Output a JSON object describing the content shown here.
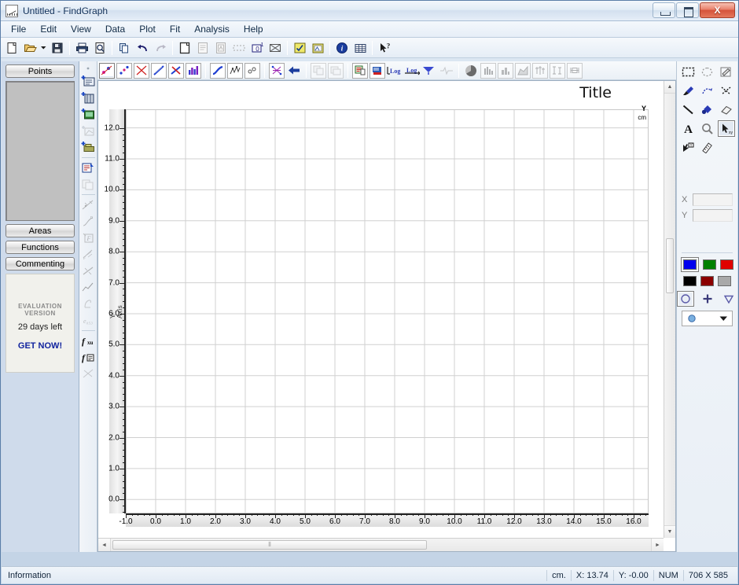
{
  "window": {
    "title": "Untitled - FindGraph",
    "icon": "findgraph-app-icon",
    "minimize": "Minimize",
    "maximize": "Restore",
    "close": "Close"
  },
  "menu": {
    "items": [
      {
        "label": "File"
      },
      {
        "label": "Edit"
      },
      {
        "label": "View"
      },
      {
        "label": "Data"
      },
      {
        "label": "Plot"
      },
      {
        "label": "Fit"
      },
      {
        "label": "Analysis"
      },
      {
        "label": "Help"
      }
    ]
  },
  "main_toolbar": {
    "items": [
      {
        "name": "new-file-icon",
        "title": "New"
      },
      {
        "name": "open-file-icon",
        "title": "Open"
      },
      {
        "name": "open-dropdown-icon",
        "title": "Open recent"
      },
      {
        "name": "save-icon",
        "title": "Save"
      },
      {
        "name": "print-icon",
        "title": "Print"
      },
      {
        "name": "print-preview-icon",
        "title": "Print Preview"
      },
      {
        "name": "copy-icon",
        "title": "Copy"
      },
      {
        "name": "undo-icon",
        "title": "Undo"
      },
      {
        "name": "redo-icon",
        "title": "Redo"
      },
      {
        "name": "new-document-icon",
        "title": "New Document"
      },
      {
        "name": "paste-document-icon",
        "title": "Paste Document"
      },
      {
        "name": "import-document-icon",
        "title": "Import"
      },
      {
        "name": "select-region-icon",
        "title": "Select Region"
      },
      {
        "name": "digitize-icon",
        "title": "Digitize"
      },
      {
        "name": "delete-region-icon",
        "title": "Delete Region"
      },
      {
        "name": "wizard-icon",
        "title": "Wizard"
      },
      {
        "name": "image-icon",
        "title": "Image"
      },
      {
        "name": "about-icon",
        "title": "About"
      },
      {
        "name": "table-icon",
        "title": "Table"
      },
      {
        "name": "help-pointer-icon",
        "title": "Context Help"
      }
    ]
  },
  "graph_toolbar": {
    "items": [
      {
        "name": "scatter-select-icon",
        "title": "Points",
        "selected": true
      },
      {
        "name": "scatter-plot-icon",
        "title": "Scatter"
      },
      {
        "name": "clear-plot-icon",
        "title": "Clear"
      },
      {
        "name": "line-plot-icon",
        "title": "Line"
      },
      {
        "name": "delete-curve-icon",
        "title": "Delete Curve"
      },
      {
        "name": "bar-plot-icon",
        "title": "Bar"
      },
      {
        "name": "smooth-curve-icon",
        "title": "Smooth"
      },
      {
        "name": "noise-icon",
        "title": "Noise"
      },
      {
        "name": "spline-icon",
        "title": "Spline"
      },
      {
        "name": "network-icon",
        "title": "Approximation"
      },
      {
        "name": "back-arrow-icon",
        "title": "Back"
      },
      {
        "name": "copy-plot-icon",
        "title": "Copy Plot"
      },
      {
        "name": "duplicate-plot-icon",
        "title": "Duplicate Plot"
      },
      {
        "name": "legend-icon",
        "title": "Legend"
      },
      {
        "name": "axis-props-icon",
        "title": "Axis Properties"
      },
      {
        "name": "log-x-icon",
        "title": "Log X"
      },
      {
        "name": "log-y-icon",
        "title": "Log Y"
      },
      {
        "name": "fft-icon",
        "title": "FFT"
      },
      {
        "name": "signal-icon",
        "title": "Signal"
      },
      {
        "name": "pie-icon",
        "title": "Pie Chart"
      },
      {
        "name": "histogram-icon",
        "title": "Histogram"
      },
      {
        "name": "column-icon",
        "title": "Column Chart"
      },
      {
        "name": "area-icon",
        "title": "Area Chart"
      },
      {
        "name": "candle-icon",
        "title": "Candlestick"
      },
      {
        "name": "errorbar-icon",
        "title": "Error Bars"
      },
      {
        "name": "boxplot-icon",
        "title": "Box Plot"
      }
    ]
  },
  "sidebar": {
    "points_button": "Points",
    "areas_button": "Areas",
    "functions_button": "Functions",
    "commenting_button": "Commenting",
    "evaluation": {
      "line1": "EVALUATION",
      "line2": "VERSION",
      "days_left": "29 days left",
      "buy_link": "GET NOW!"
    },
    "tools": [
      {
        "name": "add-series-icon",
        "title": "Add Series"
      },
      {
        "name": "add-column-icon",
        "title": "Add Column"
      },
      {
        "name": "add-image-icon",
        "title": "Add Image"
      },
      {
        "name": "add-area-icon",
        "title": "Add Area"
      },
      {
        "name": "add-folder-icon",
        "title": "Add Folder"
      },
      {
        "name": "edit-series-icon",
        "title": "Edit Series"
      },
      {
        "name": "copy-series-icon",
        "title": "Copy Series"
      },
      {
        "name": "interpolate-icon",
        "title": "Interpolate"
      },
      {
        "name": "power-fit-icon",
        "title": "Power Fit"
      },
      {
        "name": "formula-fit-icon",
        "title": "Formula Fit"
      },
      {
        "name": "fourier-icon",
        "title": "Fourier"
      },
      {
        "name": "regression-icon",
        "title": "Regression"
      },
      {
        "name": "trend-icon",
        "title": "Trend Line"
      },
      {
        "name": "smooth-hand-icon",
        "title": "Smoothing"
      },
      {
        "name": "spline-fit-icon",
        "title": "Spline Fit"
      },
      {
        "name": "function-fit-icon",
        "title": "Function Fit"
      },
      {
        "name": "function-list-icon",
        "title": "Function List"
      },
      {
        "name": "cut-curve-icon",
        "title": "Cut Curve"
      }
    ]
  },
  "right_panel": {
    "tools": [
      {
        "name": "marquee-select-icon",
        "title": "Rectangular Select"
      },
      {
        "name": "lasso-select-icon",
        "title": "Lasso Select"
      },
      {
        "name": "edit-note-icon",
        "title": "Note"
      },
      {
        "name": "eyedropper-icon",
        "title": "Eyedropper"
      },
      {
        "name": "freehand-icon",
        "title": "Freehand"
      },
      {
        "name": "delete-point-icon",
        "title": "Delete Point"
      },
      {
        "name": "line-tool-icon",
        "title": "Line"
      },
      {
        "name": "paint-bucket-icon",
        "title": "Fill"
      },
      {
        "name": "eraser-icon",
        "title": "Eraser"
      },
      {
        "name": "text-tool-icon",
        "title": "Text"
      },
      {
        "name": "zoom-icon",
        "title": "Zoom"
      },
      {
        "name": "pointer-tool-icon",
        "title": "Select",
        "selected": true
      },
      {
        "name": "move-point-icon",
        "title": "Move Point"
      },
      {
        "name": "ruler-icon",
        "title": "Measure"
      }
    ],
    "coords": {
      "x_label": "X",
      "y_label": "Y",
      "x_value": "",
      "y_value": ""
    },
    "colors": {
      "row1": [
        "#0000ee",
        "#008000",
        "#e00000"
      ],
      "row2": [
        "#000000",
        "#8b0000",
        "#a9a9a9"
      ],
      "selected_index": 0
    },
    "shapes": [
      {
        "name": "circle-marker-icon",
        "selected": true
      },
      {
        "name": "plus-marker-icon",
        "selected": false
      },
      {
        "name": "triangle-marker-icon",
        "selected": false
      }
    ],
    "marker_combo": {
      "name": "marker-style-combo",
      "value": "circle-marker"
    }
  },
  "chart_data": {
    "type": "scatter",
    "title": "Title",
    "xlabel": "",
    "ylabel": "Y-Axis",
    "y_top_symbol": "Y",
    "y_units": "cm",
    "xlim": [
      -1.0,
      16.5
    ],
    "ylim": [
      -0.45,
      12.6
    ],
    "x_ticks": [
      "-1.0",
      "0.0",
      "1.0",
      "2.0",
      "3.0",
      "4.0",
      "5.0",
      "6.0",
      "7.0",
      "8.0",
      "9.0",
      "10.0",
      "11.0",
      "12.0",
      "13.0",
      "14.0",
      "15.0",
      "16.0"
    ],
    "x_tick_values": [
      -1,
      0,
      1,
      2,
      3,
      4,
      5,
      6,
      7,
      8,
      9,
      10,
      11,
      12,
      13,
      14,
      15,
      16
    ],
    "y_ticks": [
      "12.0",
      "11.0",
      "10.0",
      "9.0",
      "8.0",
      "7.0",
      "6.0",
      "5.0",
      "4.0",
      "3.0",
      "2.0",
      "1.0",
      "0.0"
    ],
    "y_tick_values": [
      12,
      11,
      10,
      9,
      8,
      7,
      6,
      5,
      4,
      3,
      2,
      1,
      0
    ],
    "grid": true,
    "grid_color": "#d0d0d0",
    "series": [],
    "legend": "none"
  },
  "scrollbars": {
    "h_left_arrow": "◄",
    "h_right_arrow": "►",
    "v_up_arrow": "▲",
    "v_down_arrow": "▼",
    "h_grip": "⦀",
    "v_grip": "≡"
  },
  "statusbar": {
    "information": "Information",
    "units": "cm.",
    "x_readout": "X: 13.74",
    "y_readout": "Y: -0.00",
    "num_indicator": "NUM",
    "size_indicator": "706 X 585"
  }
}
